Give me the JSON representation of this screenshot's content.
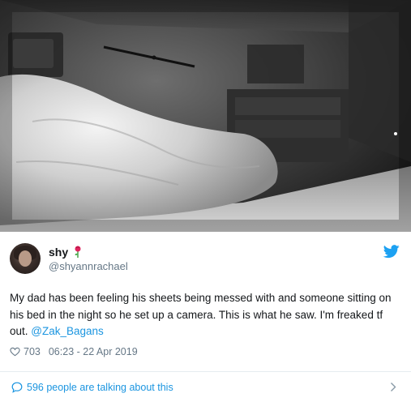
{
  "tweet": {
    "display_name": "shy",
    "handle": "@shyannrachael",
    "text_before": "My dad has been feeling his sheets being messed with and someone sitting on his bed in the night so he set up a camera. This is what he saw. I'm freaked tf out. ",
    "mention": "@Zak_Bagans",
    "likes": "703",
    "timestamp": "06:23 - 22 Apr 2019"
  },
  "footer": {
    "talking": "596 people are talking about this"
  },
  "icons": {
    "avatar": "profile-photo",
    "name_emoji": "rose-icon",
    "brand": "twitter-bird-icon",
    "likes": "heart-icon",
    "replies": "speech-bubble-icon",
    "more": "chevron-right-icon"
  },
  "colors": {
    "link": "#1b95e0",
    "muted": "#657786",
    "brand": "#1da1f2",
    "text": "#14171a"
  }
}
